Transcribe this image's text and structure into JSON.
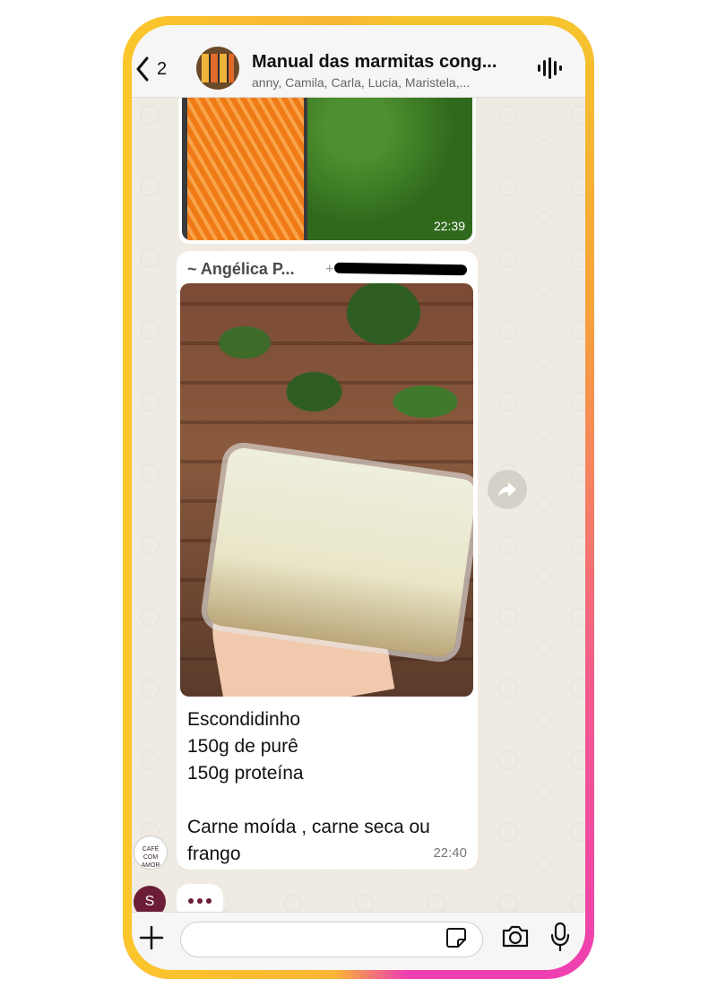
{
  "header": {
    "back_count": "2",
    "title": "Manual das marmitas cong...",
    "subtitle": "anny, Camila, Carla, Lucia, Maristela,..."
  },
  "messages": [
    {
      "time": "22:39"
    },
    {
      "sender": "~ Angélica P...",
      "phone": "+",
      "caption": "Escondidinho\n150g de purê\n150g proteína\n\nCarne moída , carne seca ou frango",
      "time": "22:40"
    }
  ],
  "sender_avatar_text": "CAFÉ COM AMOR",
  "typing_avatar_letter": "S",
  "icons": [
    "back-chevron-icon",
    "audio-wave-icon",
    "forward-icon",
    "plus-icon",
    "sticker-icon",
    "camera-icon",
    "mic-icon"
  ],
  "colors": {
    "frame_gradient_start": "#f6c42c",
    "frame_gradient_end": "#ee3fb0",
    "chat_bg": "#efeae2",
    "accent": "#6b1e36"
  }
}
